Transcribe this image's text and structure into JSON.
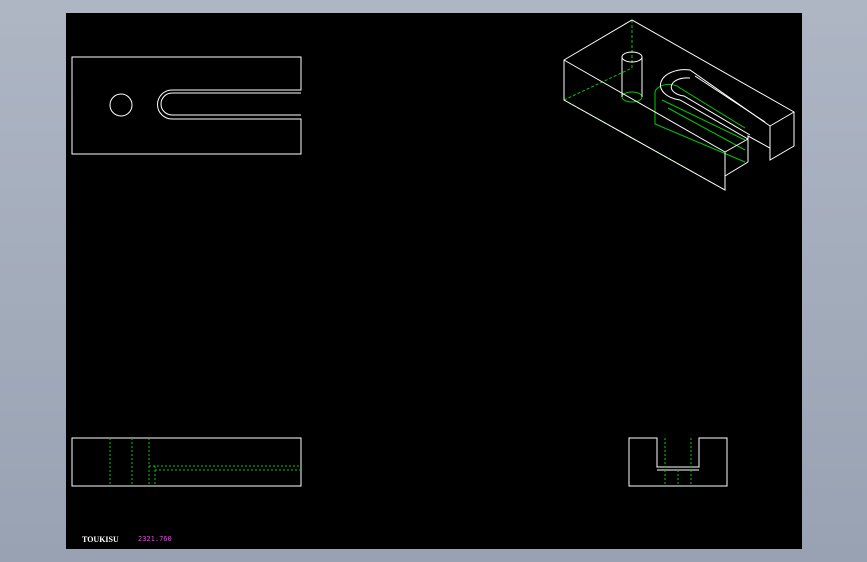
{
  "colors": {
    "background": "#a3acbb",
    "sheet": "#000000",
    "visible_line": "#ffffff",
    "hidden_line": "#00cc00",
    "dimension_text": "#ff33ff"
  },
  "footer": {
    "logo": "TOUKISU",
    "dimension": "2321.760"
  }
}
